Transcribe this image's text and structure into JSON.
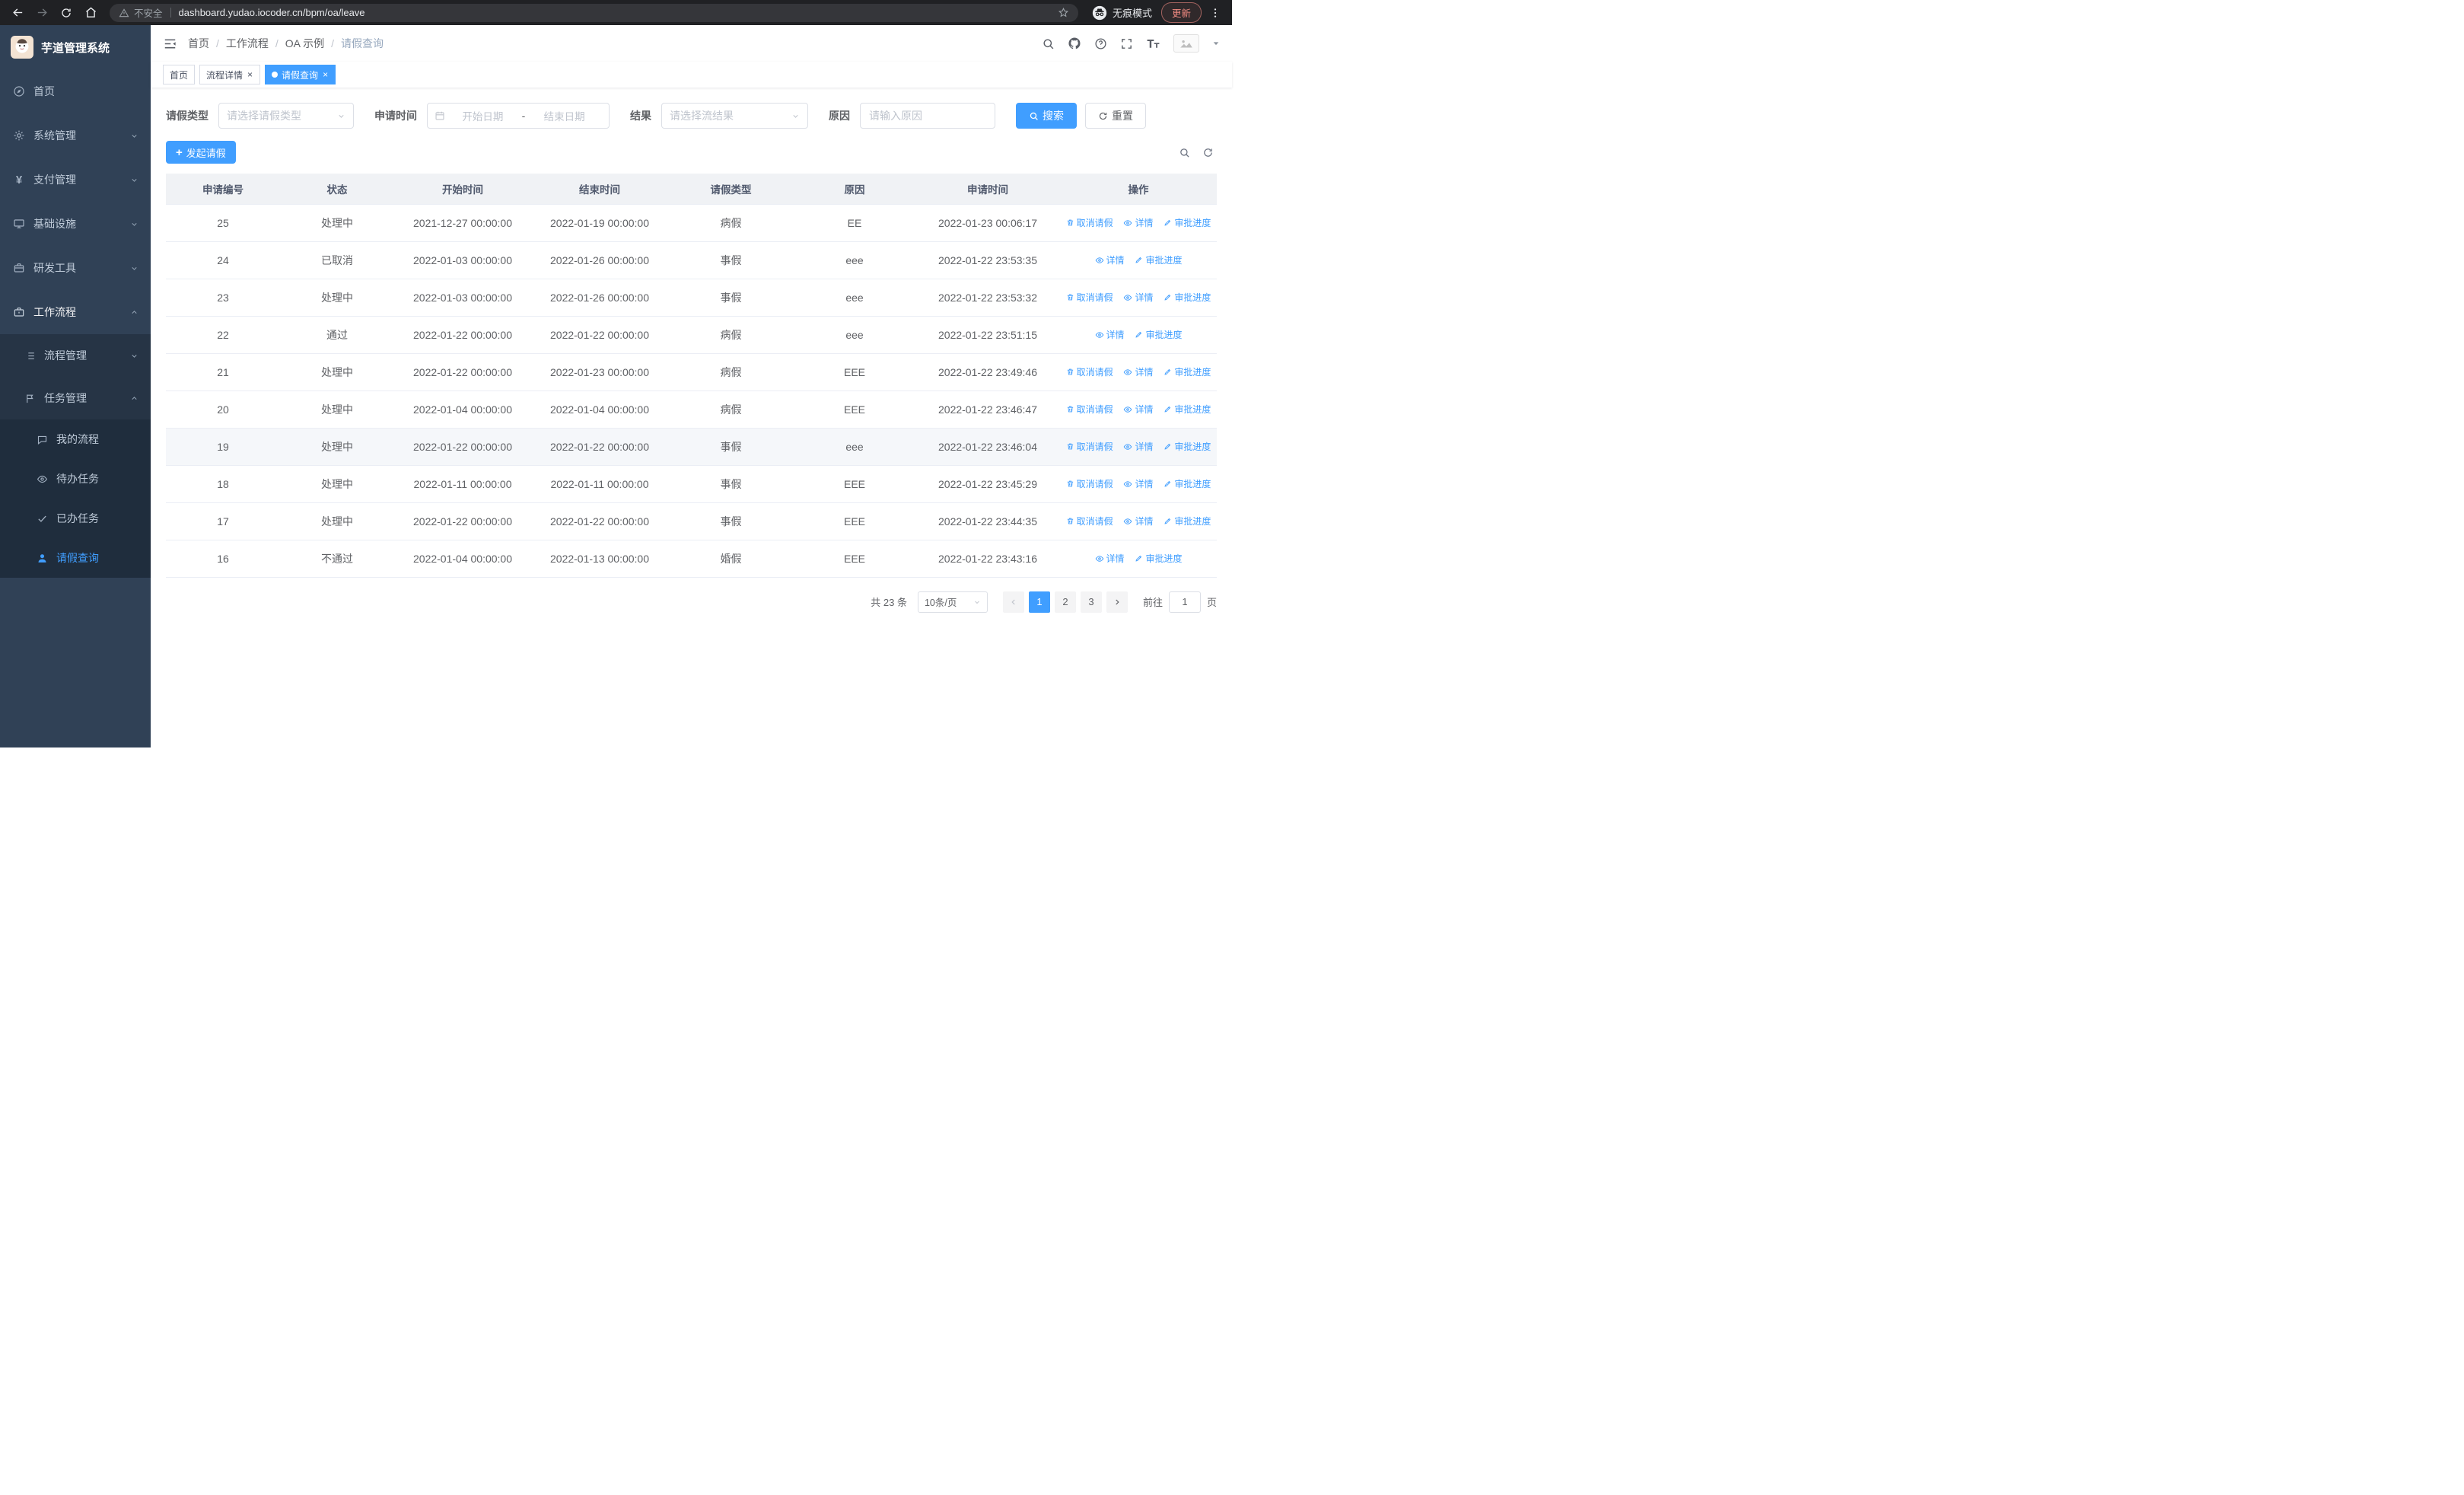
{
  "browser": {
    "security_warning": "不安全",
    "url": "dashboard.yudao.iocoder.cn/bpm/oa/leave",
    "incognito_label": "无痕模式",
    "update_button": "更新"
  },
  "sidebar": {
    "app_title": "芋道管理系统",
    "items": [
      {
        "label": "首页"
      },
      {
        "label": "系统管理"
      },
      {
        "label": "支付管理"
      },
      {
        "label": "基础设施"
      },
      {
        "label": "研发工具"
      },
      {
        "label": "工作流程"
      },
      {
        "label": "流程管理"
      },
      {
        "label": "任务管理"
      },
      {
        "label": "我的流程"
      },
      {
        "label": "待办任务"
      },
      {
        "label": "已办任务"
      },
      {
        "label": "请假查询"
      }
    ]
  },
  "breadcrumb": {
    "separator": "/",
    "items": [
      "首页",
      "工作流程",
      "OA 示例",
      "请假查询"
    ]
  },
  "tabs": [
    {
      "label": "首页"
    },
    {
      "label": "流程详情"
    },
    {
      "label": "请假查询"
    }
  ],
  "filters": {
    "leave_type_label": "请假类型",
    "leave_type_placeholder": "请选择请假类型",
    "apply_time_label": "申请时间",
    "start_date_placeholder": "开始日期",
    "range_separator": "-",
    "end_date_placeholder": "结束日期",
    "result_label": "结果",
    "result_placeholder": "请选择流结果",
    "reason_label": "原因",
    "reason_placeholder": "请输入原因",
    "search_button": "搜索",
    "reset_button": "重置"
  },
  "toolbar": {
    "create_button": "发起请假"
  },
  "table": {
    "columns": [
      "申请编号",
      "状态",
      "开始时间",
      "结束时间",
      "请假类型",
      "原因",
      "申请时间",
      "操作"
    ],
    "action_labels": {
      "cancel": "取消请假",
      "detail": "详情",
      "progress": "审批进度"
    },
    "rows": [
      {
        "id": "25",
        "status": "处理中",
        "start": "2021-12-27 00:00:00",
        "end": "2022-01-19 00:00:00",
        "type": "病假",
        "reason": "EE",
        "applied": "2022-01-23 00:06:17",
        "cancellable": true,
        "highlighted": false
      },
      {
        "id": "24",
        "status": "已取消",
        "start": "2022-01-03 00:00:00",
        "end": "2022-01-26 00:00:00",
        "type": "事假",
        "reason": "eee",
        "applied": "2022-01-22 23:53:35",
        "cancellable": false,
        "highlighted": false
      },
      {
        "id": "23",
        "status": "处理中",
        "start": "2022-01-03 00:00:00",
        "end": "2022-01-26 00:00:00",
        "type": "事假",
        "reason": "eee",
        "applied": "2022-01-22 23:53:32",
        "cancellable": true,
        "highlighted": false
      },
      {
        "id": "22",
        "status": "通过",
        "start": "2022-01-22 00:00:00",
        "end": "2022-01-22 00:00:00",
        "type": "病假",
        "reason": "eee",
        "applied": "2022-01-22 23:51:15",
        "cancellable": false,
        "highlighted": false
      },
      {
        "id": "21",
        "status": "处理中",
        "start": "2022-01-22 00:00:00",
        "end": "2022-01-23 00:00:00",
        "type": "病假",
        "reason": "EEE",
        "applied": "2022-01-22 23:49:46",
        "cancellable": true,
        "highlighted": false
      },
      {
        "id": "20",
        "status": "处理中",
        "start": "2022-01-04 00:00:00",
        "end": "2022-01-04 00:00:00",
        "type": "病假",
        "reason": "EEE",
        "applied": "2022-01-22 23:46:47",
        "cancellable": true,
        "highlighted": false
      },
      {
        "id": "19",
        "status": "处理中",
        "start": "2022-01-22 00:00:00",
        "end": "2022-01-22 00:00:00",
        "type": "事假",
        "reason": "eee",
        "applied": "2022-01-22 23:46:04",
        "cancellable": true,
        "highlighted": true
      },
      {
        "id": "18",
        "status": "处理中",
        "start": "2022-01-11 00:00:00",
        "end": "2022-01-11 00:00:00",
        "type": "事假",
        "reason": "EEE",
        "applied": "2022-01-22 23:45:29",
        "cancellable": true,
        "highlighted": false
      },
      {
        "id": "17",
        "status": "处理中",
        "start": "2022-01-22 00:00:00",
        "end": "2022-01-22 00:00:00",
        "type": "事假",
        "reason": "EEE",
        "applied": "2022-01-22 23:44:35",
        "cancellable": true,
        "highlighted": false
      },
      {
        "id": "16",
        "status": "不通过",
        "start": "2022-01-04 00:00:00",
        "end": "2022-01-13 00:00:00",
        "type": "婚假",
        "reason": "EEE",
        "applied": "2022-01-22 23:43:16",
        "cancellable": false,
        "highlighted": false
      }
    ]
  },
  "pagination": {
    "total": "共 23 条",
    "page_size": "10条/页",
    "pages": [
      "1",
      "2",
      "3"
    ],
    "goto_label": "前往",
    "goto_value": "1",
    "page_label": "页"
  },
  "colors": {
    "primary": "#409eff",
    "sidebar_bg": "#304156",
    "browser_bar": "#202124"
  }
}
